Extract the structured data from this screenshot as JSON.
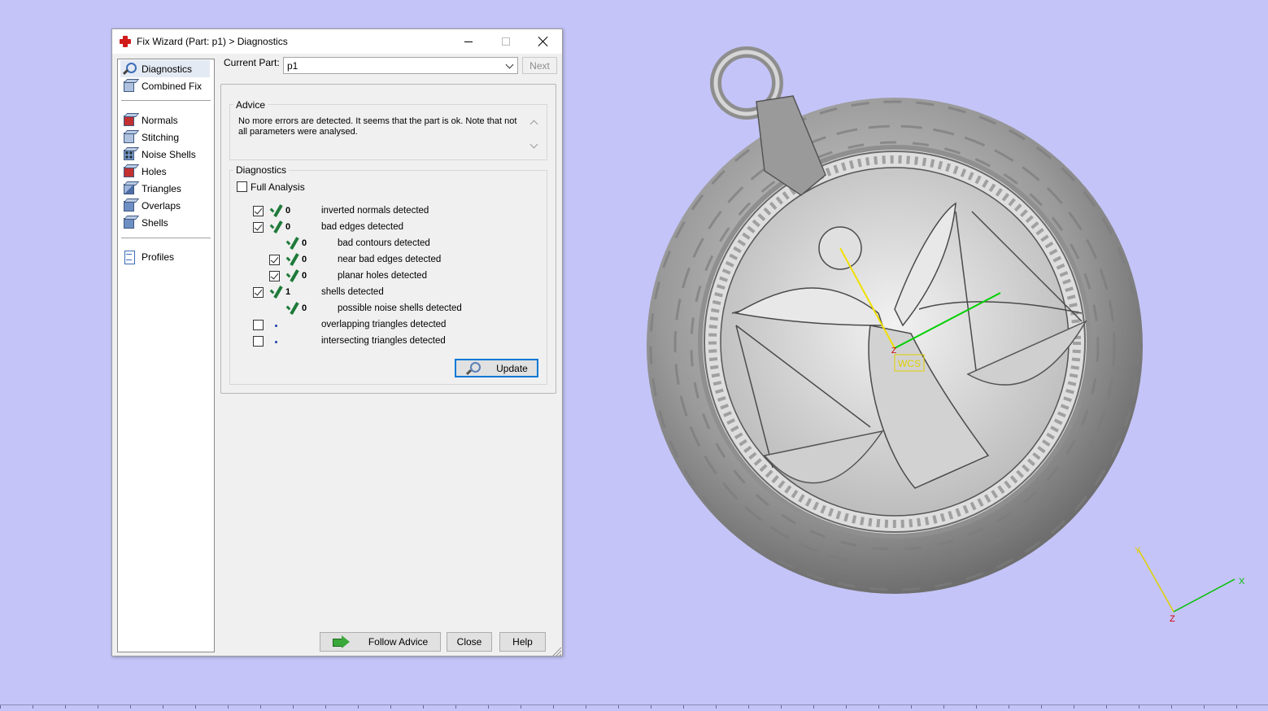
{
  "window": {
    "title": "Fix Wizard (Part: p1) > Diagnostics",
    "minimize_icon": "minimize-icon",
    "maximize_icon": "maximize-icon",
    "close_icon": "close-icon"
  },
  "sidebar": {
    "items": [
      {
        "label": "Diagnostics",
        "icon": "magnifier-icon",
        "selected": true
      },
      {
        "label": "Combined Fix",
        "icon": "cube-icon"
      },
      {
        "label": "Normals",
        "icon": "cube-icon"
      },
      {
        "label": "Stitching",
        "icon": "cube-icon"
      },
      {
        "label": "Noise Shells",
        "icon": "cube-icon"
      },
      {
        "label": "Holes",
        "icon": "cube-icon"
      },
      {
        "label": "Triangles",
        "icon": "cube-icon"
      },
      {
        "label": "Overlaps",
        "icon": "cube-icon"
      },
      {
        "label": "Shells",
        "icon": "cube-icon"
      },
      {
        "label": "Profiles",
        "icon": "document-icon"
      }
    ]
  },
  "part": {
    "label": "Current Part:",
    "value": "p1",
    "next_label": "Next"
  },
  "advice": {
    "title": "Advice",
    "text": "No more errors are detected. It seems that the part is ok. Note that not all parameters were analysed."
  },
  "diagnostics": {
    "title": "Diagnostics",
    "full_analysis_label": "Full Analysis",
    "full_analysis_checked": false,
    "rows": [
      {
        "count": "0",
        "label": "inverted normals detected",
        "checked": true
      },
      {
        "count": "0",
        "label": "bad edges detected",
        "checked": true
      },
      {
        "count": "0",
        "label": "bad contours detected"
      },
      {
        "count": "0",
        "label": "near bad edges detected",
        "checked": true
      },
      {
        "count": "0",
        "label": "planar holes detected",
        "checked": true
      },
      {
        "count": "1",
        "label": "shells detected",
        "checked": true
      },
      {
        "count": "0",
        "label": "possible noise shells detected"
      },
      {
        "count": "",
        "label": "overlapping triangles detected",
        "checked": false
      },
      {
        "count": "",
        "label": "intersecting triangles detected",
        "checked": false
      }
    ],
    "update_label": "Update"
  },
  "footer": {
    "follow_advice_label": "Follow Advice",
    "close_label": "Close",
    "help_label": "Help"
  },
  "viewport": {
    "background": "#c4c4f8",
    "wcs_label": "WCS",
    "axis_x": "X",
    "axis_y": "Y",
    "axis_z": "Z"
  }
}
